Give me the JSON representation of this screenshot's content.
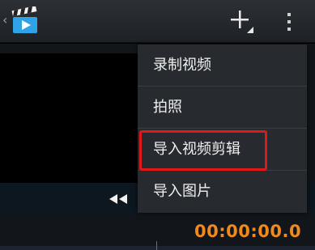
{
  "action_bar": {
    "back_glyph": "‹",
    "icons": [
      "clapperboard-icon",
      "add-icon",
      "overflow-icon"
    ]
  },
  "menu": {
    "items": [
      {
        "label": "录制视频"
      },
      {
        "label": "拍照"
      },
      {
        "label": "导入视频剪辑",
        "highlighted": true
      },
      {
        "label": "导入图片"
      }
    ]
  },
  "player": {
    "timecode": "00:00:00.0"
  },
  "colors": {
    "timecode": "#f08a1c",
    "highlight": "#e01818",
    "menu_bg": "#272a2e"
  }
}
